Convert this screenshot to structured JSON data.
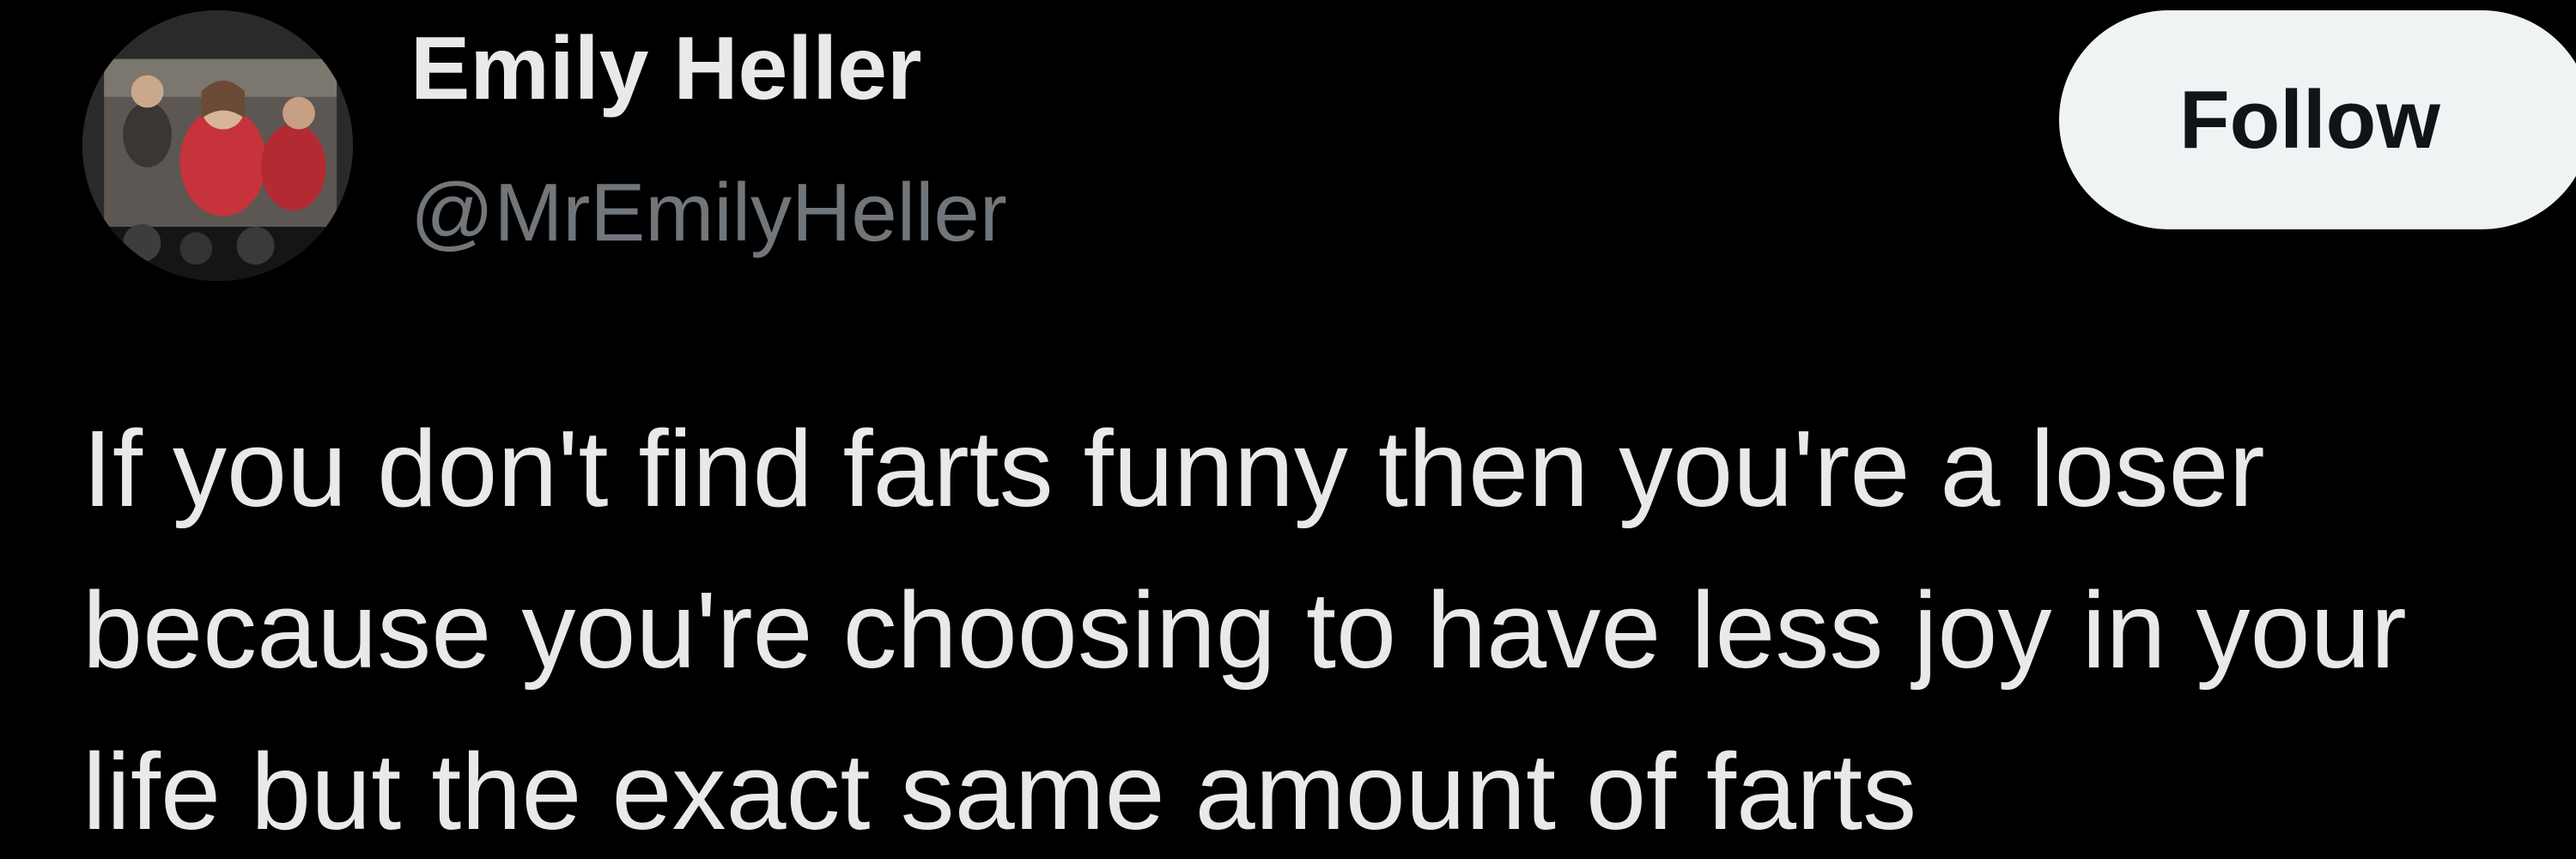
{
  "author": {
    "display_name": "Emily Heller",
    "handle": "@MrEmilyHeller",
    "avatar_icon": "profile-photo"
  },
  "actions": {
    "follow_label": "Follow"
  },
  "tweet": {
    "lines": [
      "If you don't find farts funny then you're a loser",
      "because you're choosing to have less joy in your",
      "life but the exact same amount of farts"
    ]
  },
  "colors": {
    "background": "#000000",
    "primary_text": "#e7e9ea",
    "secondary_text": "#71767b",
    "follow_button_bg": "#eff3f4",
    "follow_button_text": "#0f1419"
  }
}
